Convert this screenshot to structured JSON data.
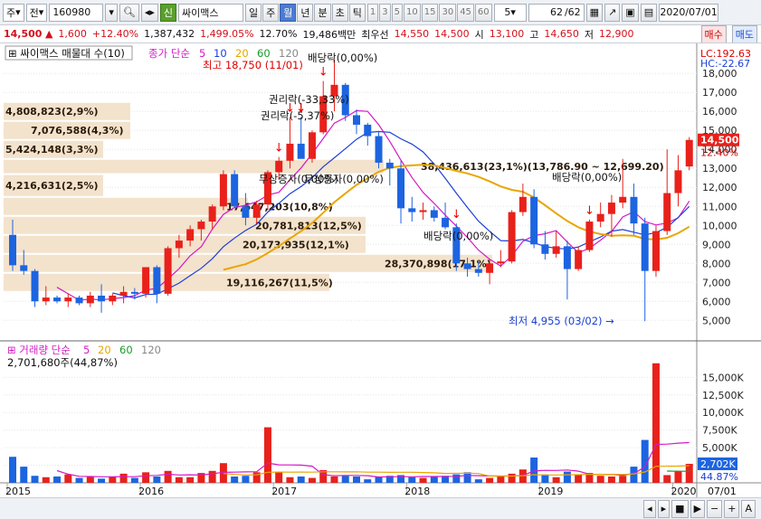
{
  "toolbar": {
    "market": "주",
    "type": "전",
    "code": "160980",
    "badge": "신",
    "name": "싸이맥스",
    "periods": [
      "일",
      "주",
      "월",
      "년",
      "분",
      "초",
      "틱"
    ],
    "selected_period": "월",
    "minute_options": [
      "1",
      "3",
      "5",
      "10",
      "15",
      "30",
      "45",
      "60"
    ],
    "count": "5",
    "page": "62",
    "page_total": "/62",
    "date": "2020/07/01"
  },
  "quote": {
    "price": "14,500",
    "arrow": "▲",
    "change": "1,600",
    "change_pct": "+12.40%",
    "volume": "1,387,432",
    "vol_ratio": "1,499.05%",
    "turnover": "12.70%",
    "amount": "19,486백만",
    "best_label": "최우선",
    "ask": "14,550",
    "bid": "14,500",
    "open_label": "시",
    "open": "13,100",
    "high_label": "고",
    "high": "14,650",
    "low_label": "저",
    "low": "12,900",
    "buy": "매수",
    "sell": "매도"
  },
  "colors": {
    "up": "#e8211b",
    "down": "#1c64e0",
    "ma5": "#d41ac4",
    "ma10": "#1e3fd8",
    "ma20": "#e8a600",
    "ma60": "#1a9a2a",
    "box": "#f3e2cc"
  },
  "price_panel": {
    "title": "싸이맥스 매물대 수(10)",
    "ma_title": "종가 단순",
    "ma_periods": [
      "5",
      "10",
      "20",
      "60",
      "120"
    ],
    "lc": "LC:192.63",
    "hc": "HC:-22.67",
    "last_price": "14,500",
    "last_pct": "12.40%",
    "high_label": "최고 18,750 (11/01)",
    "low_label": "최저 4,955 (03/02)",
    "y_ticks": [
      "18,000",
      "17,000",
      "16,000",
      "15,000",
      "14,000",
      "13,000",
      "12,000",
      "11,000",
      "10,000",
      "9,000",
      "8,000",
      "7,000",
      "6,000",
      "5,000"
    ],
    "volume_profile": [
      {
        "label": "4,808,823(2,9%)",
        "low": 15500,
        "high": 16500
      },
      {
        "label": "7,076,588(4,3%)",
        "low": 14500,
        "high": 15500
      },
      {
        "label": "5,424,148(3,3%)",
        "low": 13500,
        "high": 14500
      },
      {
        "label": "38,436,613(23,1%)(13,786.90 ~ 12,699.20)",
        "low": 12700,
        "high": 13500
      },
      {
        "label": "4,216,631(2,5%)",
        "low": 11500,
        "high": 12700
      },
      {
        "label": "17,647,203(10,8%)",
        "low": 10500,
        "high": 11500
      },
      {
        "label": "20,781,813(12,5%)",
        "low": 9500,
        "high": 10500
      },
      {
        "label": "20,173,935(12,1%)",
        "low": 8500,
        "high": 9500
      },
      {
        "label": "28,370,898(17,1%)",
        "low": 7500,
        "high": 8500
      },
      {
        "label": "19,116,267(11,5%)",
        "low": 6500,
        "high": 7500
      }
    ],
    "events": [
      {
        "label": "배당락(0,00%)",
        "i": 28
      },
      {
        "label": "권리락(-33,33%)",
        "i": 26
      },
      {
        "label": "권리락(-5,37%)",
        "i": 25
      },
      {
        "label": "무상증자(0,00%)",
        "i": 26
      },
      {
        "label": "무상증자(0,00%)",
        "i": 24
      },
      {
        "label": "배당락(0,00%)",
        "i": 40
      },
      {
        "label": "배당락(0,00%)",
        "i": 52
      }
    ]
  },
  "volume_panel": {
    "title": "거래량 단순",
    "ma_periods": [
      "5",
      "20",
      "60",
      "120"
    ],
    "value_label": "2,701,680주(44,87%)",
    "y_ticks": [
      "15,000K",
      "12,500K",
      "10,000K",
      "7,500K",
      "5,000K",
      "2,500K"
    ],
    "last_volume": "2,702K",
    "last_pct": "44.87%"
  },
  "x_axis": {
    "labels": [
      "2015",
      "2016",
      "2017",
      "2018",
      "2019",
      "2020",
      "07/01"
    ]
  },
  "chart_data": {
    "type": "candlestick",
    "period": "monthly",
    "candles": [
      {
        "o": 9500,
        "h": 10300,
        "l": 7600,
        "c": 7900
      },
      {
        "o": 7900,
        "h": 8700,
        "l": 7400,
        "c": 7600
      },
      {
        "o": 7600,
        "h": 7700,
        "l": 5700,
        "c": 6000
      },
      {
        "o": 6000,
        "h": 6800,
        "l": 5800,
        "c": 6200
      },
      {
        "o": 6200,
        "h": 6300,
        "l": 5900,
        "c": 6000
      },
      {
        "o": 6000,
        "h": 6400,
        "l": 5700,
        "c": 6200
      },
      {
        "o": 6200,
        "h": 6300,
        "l": 5800,
        "c": 5900
      },
      {
        "o": 5900,
        "h": 6500,
        "l": 5700,
        "c": 6300
      },
      {
        "o": 6300,
        "h": 6900,
        "l": 5400,
        "c": 6000
      },
      {
        "o": 6000,
        "h": 6400,
        "l": 5800,
        "c": 6300
      },
      {
        "o": 6300,
        "h": 6800,
        "l": 5900,
        "c": 6500
      },
      {
        "o": 6500,
        "h": 6700,
        "l": 6100,
        "c": 6400
      },
      {
        "o": 6400,
        "h": 7800,
        "l": 6200,
        "c": 7800
      },
      {
        "o": 7800,
        "h": 7900,
        "l": 5900,
        "c": 6400
      },
      {
        "o": 6400,
        "h": 8900,
        "l": 6300,
        "c": 8800
      },
      {
        "o": 8800,
        "h": 9500,
        "l": 8300,
        "c": 9200
      },
      {
        "o": 9200,
        "h": 10000,
        "l": 8900,
        "c": 9800
      },
      {
        "o": 9800,
        "h": 10300,
        "l": 9200,
        "c": 10200
      },
      {
        "o": 10200,
        "h": 11100,
        "l": 9800,
        "c": 11000
      },
      {
        "o": 11000,
        "h": 12900,
        "l": 10800,
        "c": 12700
      },
      {
        "o": 12700,
        "h": 12900,
        "l": 10900,
        "c": 11000
      },
      {
        "o": 11000,
        "h": 11700,
        "l": 10000,
        "c": 10400
      },
      {
        "o": 10400,
        "h": 11300,
        "l": 10100,
        "c": 11100
      },
      {
        "o": 11100,
        "h": 12900,
        "l": 10800,
        "c": 12800
      },
      {
        "o": 12800,
        "h": 13600,
        "l": 12400,
        "c": 13400
      },
      {
        "o": 13400,
        "h": 15700,
        "l": 13000,
        "c": 14300
      },
      {
        "o": 14300,
        "h": 15700,
        "l": 13800,
        "c": 13500
      },
      {
        "o": 13500,
        "h": 15000,
        "l": 13300,
        "c": 14900
      },
      {
        "o": 14900,
        "h": 17600,
        "l": 14800,
        "c": 16800
      },
      {
        "o": 16800,
        "h": 18750,
        "l": 16000,
        "c": 17400
      },
      {
        "o": 17400,
        "h": 17500,
        "l": 15500,
        "c": 15800
      },
      {
        "o": 15800,
        "h": 16100,
        "l": 14800,
        "c": 15300
      },
      {
        "o": 15300,
        "h": 15400,
        "l": 14200,
        "c": 14700
      },
      {
        "o": 14700,
        "h": 14900,
        "l": 13000,
        "c": 13300
      },
      {
        "o": 13300,
        "h": 13500,
        "l": 12100,
        "c": 13000
      },
      {
        "o": 13000,
        "h": 13400,
        "l": 10100,
        "c": 10900
      },
      {
        "o": 10900,
        "h": 11500,
        "l": 10200,
        "c": 10700
      },
      {
        "o": 10700,
        "h": 11200,
        "l": 10300,
        "c": 10800
      },
      {
        "o": 10800,
        "h": 11000,
        "l": 10200,
        "c": 10400
      },
      {
        "o": 10400,
        "h": 11200,
        "l": 9800,
        "c": 9900
      },
      {
        "o": 9900,
        "h": 10100,
        "l": 7600,
        "c": 8000
      },
      {
        "o": 8000,
        "h": 8300,
        "l": 7300,
        "c": 7700
      },
      {
        "o": 7700,
        "h": 8100,
        "l": 7300,
        "c": 7500
      },
      {
        "o": 7500,
        "h": 8200,
        "l": 6900,
        "c": 8000
      },
      {
        "o": 8000,
        "h": 8700,
        "l": 7800,
        "c": 8100
      },
      {
        "o": 8100,
        "h": 10800,
        "l": 8000,
        "c": 10700
      },
      {
        "o": 10700,
        "h": 12200,
        "l": 10500,
        "c": 11500
      },
      {
        "o": 11500,
        "h": 11900,
        "l": 8800,
        "c": 9000
      },
      {
        "o": 9000,
        "h": 9700,
        "l": 8200,
        "c": 8500
      },
      {
        "o": 8500,
        "h": 9700,
        "l": 8300,
        "c": 8900
      },
      {
        "o": 8900,
        "h": 9200,
        "l": 6100,
        "c": 7700
      },
      {
        "o": 7700,
        "h": 8900,
        "l": 7600,
        "c": 8700
      },
      {
        "o": 8700,
        "h": 10300,
        "l": 8600,
        "c": 10200
      },
      {
        "o": 10200,
        "h": 11200,
        "l": 9900,
        "c": 10600
      },
      {
        "o": 10600,
        "h": 11600,
        "l": 9400,
        "c": 11200
      },
      {
        "o": 11200,
        "h": 13500,
        "l": 10900,
        "c": 11500
      },
      {
        "o": 11500,
        "h": 12200,
        "l": 9500,
        "c": 10100
      },
      {
        "o": 10100,
        "h": 10400,
        "l": 4955,
        "c": 7600
      },
      {
        "o": 7600,
        "h": 10000,
        "l": 7300,
        "c": 9700
      },
      {
        "o": 9700,
        "h": 14000,
        "l": 9500,
        "c": 11700
      },
      {
        "o": 11700,
        "h": 13700,
        "l": 11000,
        "c": 12900
      },
      {
        "o": 13100,
        "h": 14650,
        "l": 12900,
        "c": 14500
      }
    ],
    "volume_k": [
      3700,
      2300,
      1000,
      800,
      900,
      1200,
      700,
      900,
      600,
      900,
      1300,
      700,
      1500,
      900,
      1700,
      800,
      800,
      1400,
      1700,
      2800,
      900,
      1000,
      1500,
      1900,
      1500,
      800,
      900,
      700,
      1800,
      900,
      1000,
      900,
      500,
      900,
      1000,
      1100,
      800,
      700,
      900,
      1000,
      1200,
      1500,
      500,
      700,
      900,
      1300,
      1900,
      3600,
      1200,
      800,
      1600,
      1100,
      1400,
      1000,
      900,
      1000,
      2300,
      900,
      1200,
      1100,
      1700,
      2702
    ],
    "vol_big": [
      {
        "i": 23,
        "v": 7900
      },
      {
        "i": 58,
        "v": 17000
      },
      {
        "i": 57,
        "v": 6100
      }
    ]
  }
}
